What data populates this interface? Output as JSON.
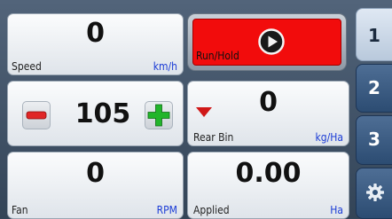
{
  "speed": {
    "value": "0",
    "label": "Speed",
    "unit": "km/h"
  },
  "run_hold": {
    "label": "Run/Hold",
    "color": "#f20c0c"
  },
  "rate": {
    "value": "105"
  },
  "rear_bin": {
    "value": "0",
    "label": "Rear Bin",
    "unit": "kg/Ha",
    "indicator_color": "#d01818"
  },
  "fan": {
    "value": "0",
    "label": "Fan",
    "unit": "RPM"
  },
  "applied": {
    "value": "0.00",
    "label": "Applied",
    "unit": "Ha"
  },
  "tabs": [
    {
      "label": "1",
      "active": true
    },
    {
      "label": "2",
      "active": false
    },
    {
      "label": "3",
      "active": false
    },
    {
      "label": "",
      "icon": "settings-gear-icon",
      "active": false
    }
  ]
}
